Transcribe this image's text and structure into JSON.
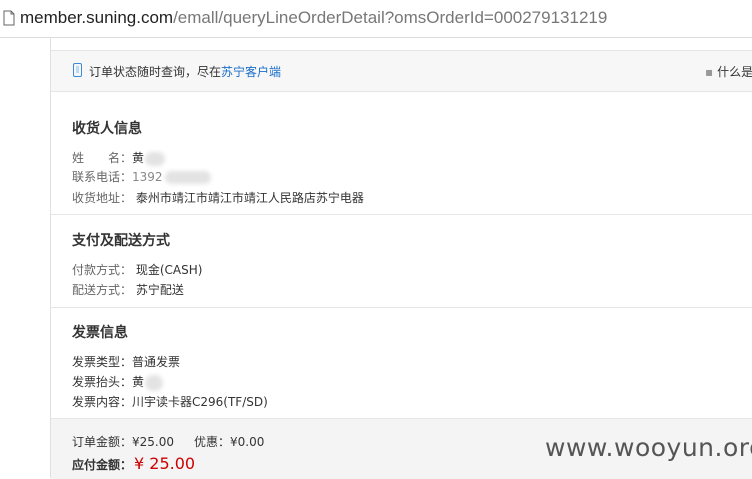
{
  "browser": {
    "url_host": "member.suning.com",
    "url_path": "/emall/queryLineOrderDetail?omsOrderId=000279131219"
  },
  "notice": {
    "text": "订单状态随时查询，尽在",
    "link": "苏宁客户端",
    "right_text": "什么是"
  },
  "consignee": {
    "title": "收货人信息",
    "name_label": "姓　　名：",
    "name_value": "黄",
    "phone_label": "联系电话：",
    "phone_value": "1392",
    "address_label": "收货地址：",
    "address_value": "泰州市靖江市靖江市靖江人民路店苏宁电器"
  },
  "payment": {
    "title": "支付及配送方式",
    "pay_label": "付款方式：",
    "pay_value": "现金(CASH)",
    "ship_label": "配送方式：",
    "ship_value": "苏宁配送"
  },
  "invoice": {
    "title": "发票信息",
    "type_label": "发票类型：",
    "type_value": "普通发票",
    "header_label": "发票抬头：",
    "header_value": "黄",
    "content_label": "发票内容：",
    "content_value": "川宇读卡器C296(TF/SD)"
  },
  "summary": {
    "order_amount_label": "订单金额：",
    "order_amount_value": "¥25.00",
    "discount_label": "优惠：",
    "discount_value": "¥0.00",
    "payable_label": "应付金额：",
    "payable_value": "¥ 25.00"
  },
  "watermark": "www.wooyun.org",
  "colors": {
    "link": "#1a6fc9",
    "amount": "#cc0000"
  }
}
